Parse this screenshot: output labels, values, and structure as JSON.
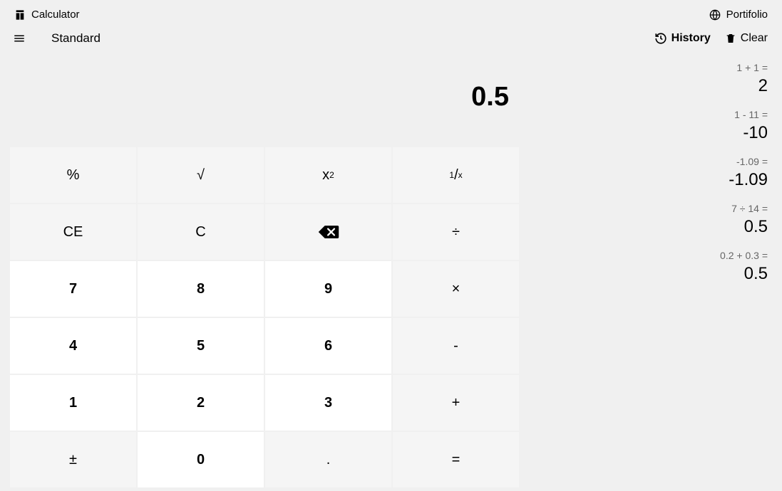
{
  "header": {
    "title": "Calculator",
    "portfolio": "Portifolio"
  },
  "subheader": {
    "mode": "Standard",
    "history": "History",
    "clear": "Clear"
  },
  "display": "0.5",
  "keys": {
    "percent": "%",
    "sqrt": "√",
    "ce": "CE",
    "c": "C",
    "divide": "÷",
    "multiply": "×",
    "minus": "-",
    "plus": "+",
    "equals": "=",
    "negate": "±",
    "dot": ".",
    "n7": "7",
    "n8": "8",
    "n9": "9",
    "n4": "4",
    "n5": "5",
    "n6": "6",
    "n1": "1",
    "n2": "2",
    "n3": "3",
    "n0": "0"
  },
  "history": [
    {
      "expr": "1 + 1 =",
      "result": "2"
    },
    {
      "expr": "1 - 11 =",
      "result": "-10"
    },
    {
      "expr": "-1.09 =",
      "result": "-1.09"
    },
    {
      "expr": "7 ÷ 14 =",
      "result": "0.5"
    },
    {
      "expr": "0.2 + 0.3 =",
      "result": "0.5"
    }
  ]
}
